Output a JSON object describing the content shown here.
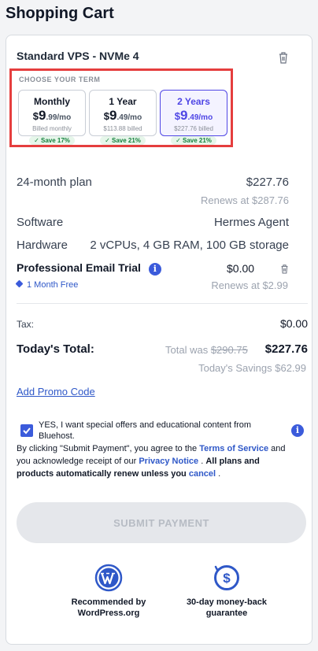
{
  "page": {
    "title": "Shopping Cart"
  },
  "product": {
    "name": "Standard VPS - NVMe 4"
  },
  "term": {
    "heading": "CHOOSE YOUR TERM",
    "options": [
      {
        "name": "Monthly",
        "currency": "$",
        "price_main": "9",
        "price_rest": ".99/mo",
        "billed": "Billed monthly",
        "save": "Save 17%",
        "selected": false
      },
      {
        "name": "1 Year",
        "currency": "$",
        "price_main": "9",
        "price_rest": ".49/mo",
        "billed": "$113.88 billed",
        "save": "Save 21%",
        "selected": false
      },
      {
        "name": "2 Years",
        "currency": "$",
        "price_main": "9",
        "price_rest": ".49/mo",
        "billed": "$227.76 billed",
        "save": "Save 21%",
        "selected": true
      }
    ]
  },
  "plan": {
    "label": "24-month plan",
    "price": "$227.76",
    "renews": "Renews at $287.76"
  },
  "software": {
    "label": "Software",
    "value": "Hermes Agent"
  },
  "hardware": {
    "label": "Hardware",
    "value": "2 vCPUs, 4 GB RAM, 100 GB storage"
  },
  "email_trial": {
    "title": "Professional Email Trial",
    "price": "$0.00",
    "tag": "1 Month Free",
    "renews": "Renews at $2.99"
  },
  "tax": {
    "label": "Tax:",
    "value": "$0.00"
  },
  "total": {
    "label": "Today's Total:",
    "was_prefix": "Total was",
    "was_value": "$290.75",
    "value": "$227.76",
    "savings": "Today's Savings $62.99"
  },
  "promo": {
    "label": "Add Promo Code"
  },
  "offers": {
    "text": "YES, I want special offers and educational content from Bluehost.",
    "checked": true
  },
  "legal": {
    "part1": "By clicking \"Submit Payment\", you agree to the",
    "tos": "Terms of Service",
    "part2": "and you acknowledge receipt of our",
    "privacy": "Privacy Notice",
    "part3": ".",
    "bold": "All plans and products automatically renew unless you",
    "cancel": "cancel",
    "end": "."
  },
  "submit": {
    "label": "SUBMIT PAYMENT"
  },
  "badges": [
    {
      "icon": "wordpress-icon",
      "label_line1": "Recommended by",
      "label_line2": "WordPress.org"
    },
    {
      "icon": "money-back-icon",
      "label_line1": "30-day money-back",
      "label_line2": "guarantee"
    }
  ],
  "colors": {
    "accent": "#3b5bdb",
    "selected": "#4f46e5",
    "highlight_border": "#e53e3e",
    "save_green": "#15803d"
  }
}
